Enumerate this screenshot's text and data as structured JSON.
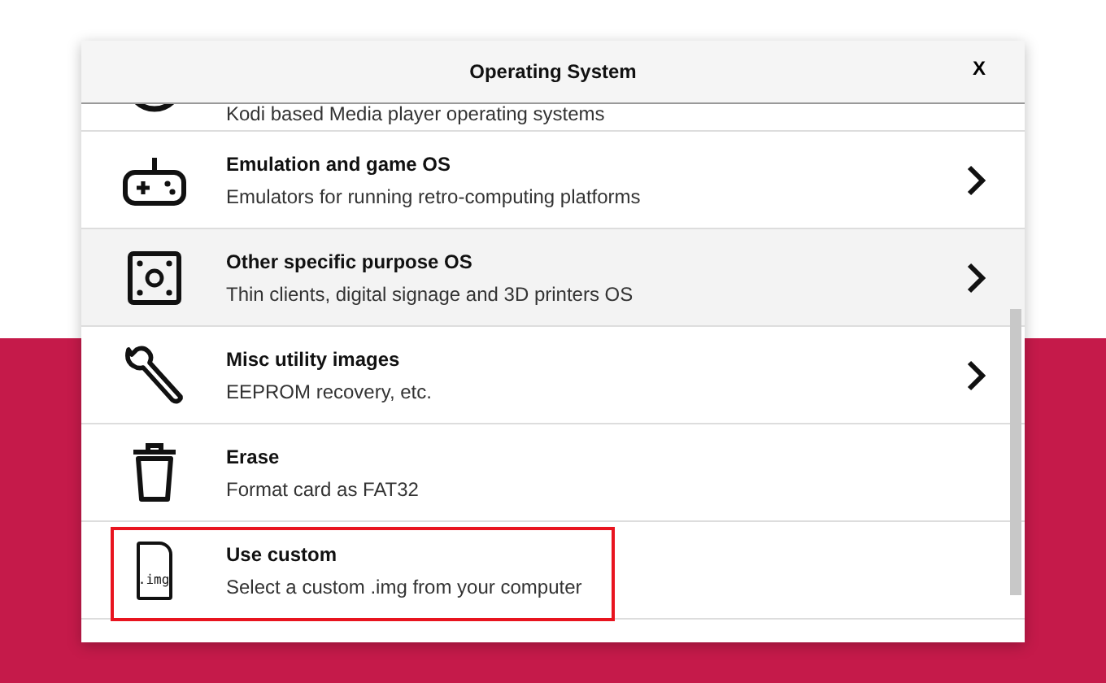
{
  "dialog": {
    "title": "Operating System",
    "close": "X"
  },
  "rows": [
    {
      "description": "Kodi based Media player operating systems",
      "highlighted": false,
      "annotated": false
    },
    {
      "title": "Emulation and game OS",
      "description": "Emulators for running retro-computing platforms",
      "submenu": true,
      "highlighted": false,
      "annotated": false
    },
    {
      "title": "Other specific purpose OS",
      "description": "Thin clients, digital signage and 3D printers OS",
      "submenu": true,
      "highlighted": true,
      "annotated": false
    },
    {
      "title": "Misc utility images",
      "description": "EEPROM recovery, etc.",
      "submenu": true,
      "highlighted": false,
      "annotated": false
    },
    {
      "title": "Erase",
      "description": "Format card as FAT32",
      "submenu": false,
      "highlighted": false,
      "annotated": false
    },
    {
      "title": "Use custom",
      "description": "Select a custom .img from your computer",
      "submenu": false,
      "highlighted": false,
      "annotated": true,
      "icon_text": ".img"
    }
  ]
}
